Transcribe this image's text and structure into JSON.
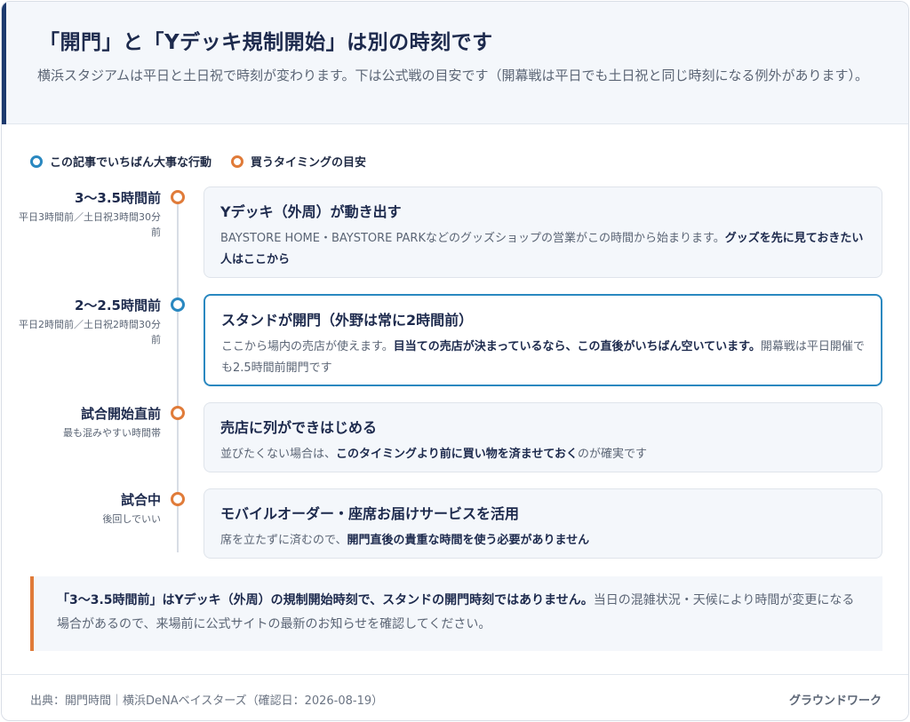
{
  "header": {
    "title": "「開門」と「Yデッキ規制開始」は別の時刻です",
    "subtitle": "横浜スタジアムは平日と土日祝で時刻が変わります。下は公式戦の目安です（開幕戦は平日でも土日祝と同じ時刻になる例外があります）。"
  },
  "legend": {
    "blue_label": "この記事でいちばん大事な行動",
    "orange_label": "買うタイミングの目安"
  },
  "timeline": [
    {
      "time": "3〜3.5時間前",
      "sub": "平日3時間前／土日祝3時間30分前",
      "title": "Yデッキ（外周）が動き出す",
      "text": "BAYSTORE HOME・BAYSTORE PARKなどのグッズショップの営業がこの時間から始まります。",
      "bold": "グッズを先に見ておきたい人はここから",
      "text_after": ""
    },
    {
      "time": "2〜2.5時間前",
      "sub": "平日2時間前／土日祝2時間30分前",
      "title": "スタンドが開門（外野は常に2時間前）",
      "text": "ここから場内の売店が使えます。",
      "bold": "目当ての売店が決まっているなら、この直後がいちばん空いています。",
      "text_after": "開幕戦は平日開催でも2.5時間前開門です"
    },
    {
      "time": "試合開始直前",
      "sub": "最も混みやすい時間帯",
      "title": "売店に列ができはじめる",
      "text": "並びたくない場合は、",
      "bold": "このタイミングより前に買い物を済ませておく",
      "text_after": "のが確実です"
    },
    {
      "time": "試合中",
      "sub": "後回しでいい",
      "title": "モバイルオーダー・座席お届けサービスを活用",
      "text": "席を立たずに済むので、",
      "bold": "開門直後の貴重な時間を使う必要がありません",
      "text_after": ""
    }
  ],
  "note": {
    "bold": "「3〜3.5時間前」はYデッキ（外周）の規制開始時刻で、スタンドの開門時刻ではありません。",
    "text": "当日の混雑状況・天候により時間が変更になる場合があるので、来場前に公式サイトの最新のお知らせを確認してください。"
  },
  "footer": {
    "source": "出典：開門時間｜横浜DeNAベイスターズ（確認日：2026-08-19）",
    "brand": "グラウンドワーク"
  },
  "colors": {
    "navy": "#1d3a6e",
    "blue": "#2a88c0",
    "orange": "#e07b39"
  }
}
